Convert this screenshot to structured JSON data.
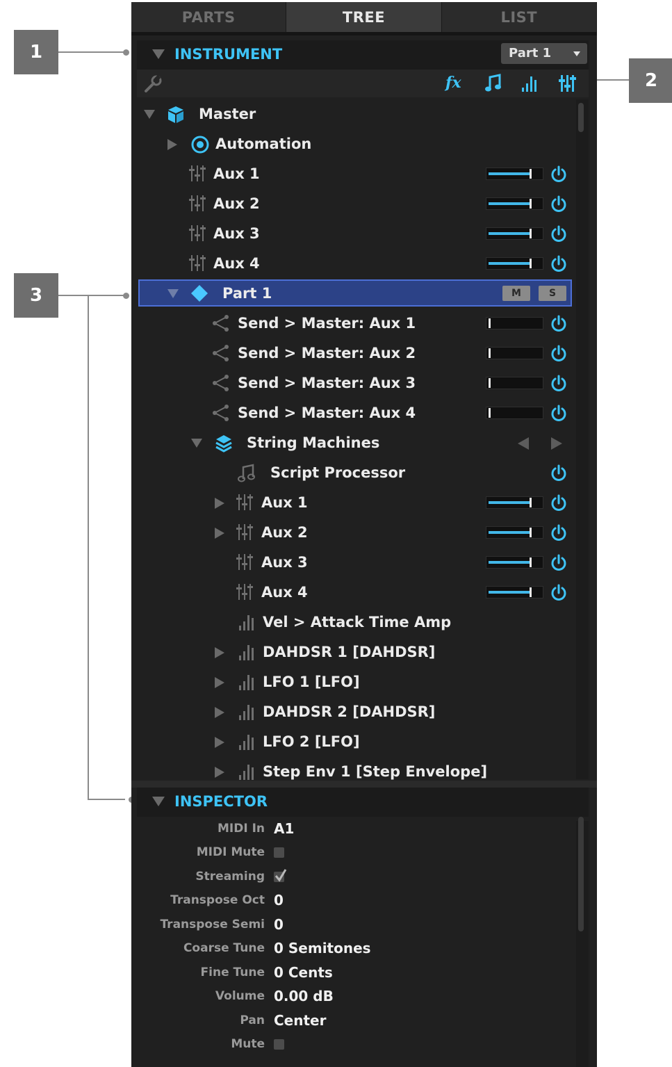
{
  "callouts": [
    "1",
    "2",
    "3"
  ],
  "tabs": [
    "PARTS",
    "TREE",
    "LIST"
  ],
  "instrument": {
    "title": "INSTRUMENT",
    "part_select": "Part 1"
  },
  "toolbar": {
    "icons": [
      "wrench-icon",
      "fx-icon",
      "note-icon",
      "bars-icon",
      "mixer-icon"
    ],
    "fx_label": "fx"
  },
  "tree": {
    "master": "Master",
    "automation": "Automation",
    "master_aux": [
      "Aux 1",
      "Aux 2",
      "Aux 3",
      "Aux 4"
    ],
    "part": "Part 1",
    "mute_label": "M",
    "solo_label": "S",
    "sends": [
      "Send > Master: Aux 1",
      "Send > Master: Aux 2",
      "Send > Master: Aux 3",
      "Send > Master: Aux 4"
    ],
    "layer": "String Machines",
    "script": "Script Processor",
    "layer_aux": [
      "Aux 1",
      "Aux 2",
      "Aux 3",
      "Aux 4"
    ],
    "modulators": [
      "Vel > Attack Time Amp",
      "DAHDSR 1 [DAHDSR]",
      "LFO 1 [LFO]",
      "DAHDSR 2 [DAHDSR]",
      "LFO 2 [LFO]",
      "Step Env 1 [Step Envelope]"
    ]
  },
  "inspector": {
    "title": "INSPECTOR",
    "midi_in_label": "MIDI In",
    "midi_in": "A1",
    "midi_mute_label": "MIDI Mute",
    "midi_mute": false,
    "streaming_label": "Streaming",
    "streaming": true,
    "transpose_oct_label": "Transpose Oct",
    "transpose_oct": "0",
    "transpose_semi_label": "Transpose Semi",
    "transpose_semi": "0",
    "coarse_tune_label": "Coarse Tune",
    "coarse_tune": "0 Semitones",
    "fine_tune_label": "Fine Tune",
    "fine_tune": "0 Cents",
    "volume_label": "Volume",
    "volume": "0.00 dB",
    "pan_label": "Pan",
    "pan": "Center",
    "mute_label": "Mute",
    "mute": false
  },
  "colors": {
    "accent": "#3ec3f5",
    "selection": "#2c4287",
    "panel": "#202020"
  }
}
